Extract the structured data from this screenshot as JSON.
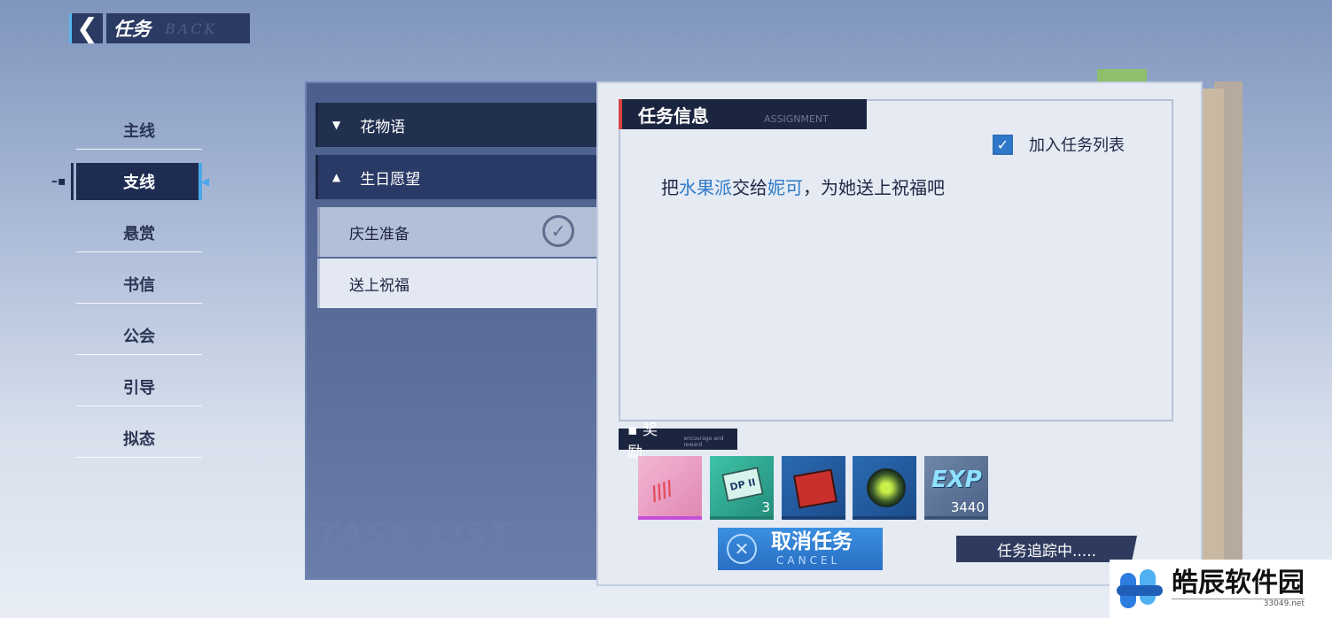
{
  "header": {
    "back_icon": "chevron-left-icon",
    "title": "任务",
    "subtitle": "BACK"
  },
  "nav": {
    "items": [
      {
        "label": "主线"
      },
      {
        "label": "支线",
        "active": true
      },
      {
        "label": "悬赏"
      },
      {
        "label": "书信"
      },
      {
        "label": "公会"
      },
      {
        "label": "引导"
      },
      {
        "label": "拟态"
      }
    ]
  },
  "task_list": {
    "watermark": "TASK LIST",
    "categories": [
      {
        "label": "花物语",
        "state": "collapsed"
      },
      {
        "label": "生日愿望",
        "state": "expanded"
      }
    ],
    "tasks": [
      {
        "label": "庆生准备",
        "status": "completed"
      },
      {
        "label": "送上祝福",
        "status": "selected"
      }
    ]
  },
  "info": {
    "title": "任务信息",
    "title_sub": "ASSIGNMENT",
    "add_to_list": {
      "label": "加入任务列表",
      "checked": true
    },
    "description": {
      "part1": "把",
      "item": "水果派",
      "part2": "交给",
      "npc": "妮可",
      "part3": "，为她送上祝福吧"
    },
    "highlight_color": "#2e7cc8"
  },
  "rewards": {
    "title": "奖励",
    "title_sub": "encourage and reward",
    "items": [
      {
        "icon": "pink-material-icon",
        "count": ""
      },
      {
        "icon": "dp-card-icon",
        "label": "DP II",
        "count": "3"
      },
      {
        "icon": "red-crate-icon",
        "count": ""
      },
      {
        "icon": "green-orb-icon",
        "count": ""
      },
      {
        "icon": "exp-icon",
        "label": "EXP",
        "count": "3440"
      }
    ]
  },
  "actions": {
    "cancel_main": "取消任务",
    "cancel_sub": "CANCEL",
    "tracking": "任务追踪中....."
  },
  "watermark": {
    "name": "皓辰软件园",
    "url": "33049.net"
  }
}
